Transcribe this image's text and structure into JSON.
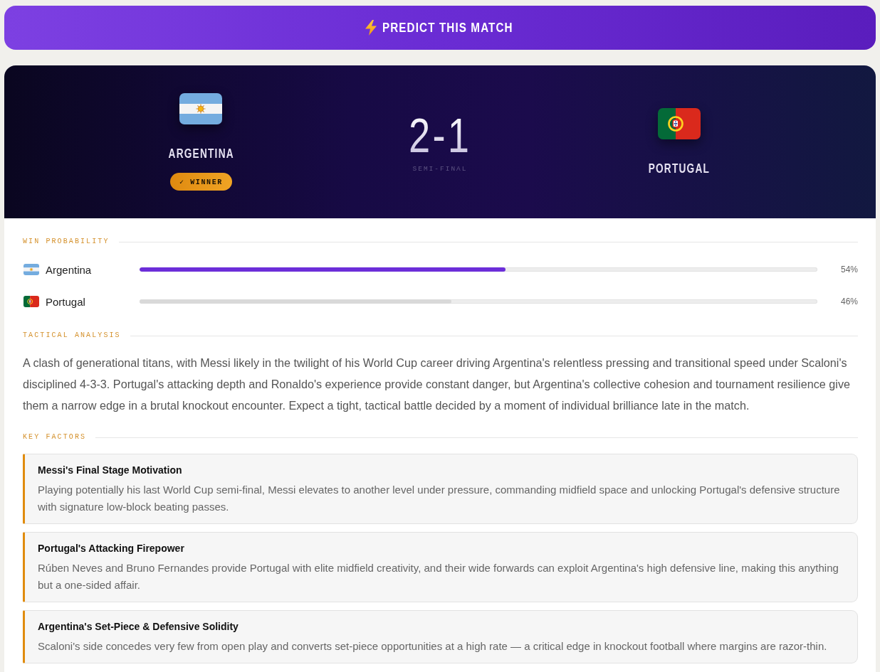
{
  "predict_button": {
    "label": "PREDICT THIS MATCH"
  },
  "match": {
    "teams": [
      {
        "kind": "argentina",
        "name": "ARGENTINA",
        "winner": true
      },
      {
        "kind": "portugal",
        "name": "PORTUGAL",
        "winner": false
      }
    ],
    "winner_badge": "✓ WINNER",
    "score": "2-1",
    "stage": "SEMI-FINAL"
  },
  "win_probability": {
    "title": "WIN PROBABILITY",
    "rows": [
      {
        "kind": "argentina",
        "name": "Argentina",
        "level": 0.54,
        "reading": "54%",
        "leading": true
      },
      {
        "kind": "portugal",
        "name": "Portugal",
        "level": 0.46,
        "reading": "46%",
        "leading": false
      }
    ]
  },
  "tactical_analysis": {
    "title": "TACTICAL ANALYSIS",
    "text": "A clash of generational titans, with Messi likely in the twilight of his World Cup career driving Argentina's relentless pressing and transitional speed under Scaloni's disciplined 4-3-3. Portugal's attacking depth and Ronaldo's experience provide constant danger, but Argentina's collective cohesion and tournament resilience give them a narrow edge in a brutal knockout encounter. Expect a tight, tactical battle decided by a moment of individual brilliance late in the match."
  },
  "key_factors": {
    "title": "KEY FACTORS",
    "items": [
      {
        "title": "Messi's Final Stage Motivation",
        "text": "Playing potentially his last World Cup semi-final, Messi elevates to another level under pressure, commanding midfield space and unlocking Portugal's defensive structure with signature low-block beating passes."
      },
      {
        "title": "Portugal's Attacking Firepower",
        "text": "Rúben Neves and Bruno Fernandes provide Portugal with elite midfield creativity, and their wide forwards can exploit Argentina's high defensive line, making this anything but a one-sided affair."
      },
      {
        "title": "Argentina's Set-Piece & Defensive Solidity",
        "text": "Scaloni's side concedes very few from open play and converts set-piece opportunities at a high rate — a critical edge in knockout football where margins are razor-thin."
      }
    ]
  }
}
